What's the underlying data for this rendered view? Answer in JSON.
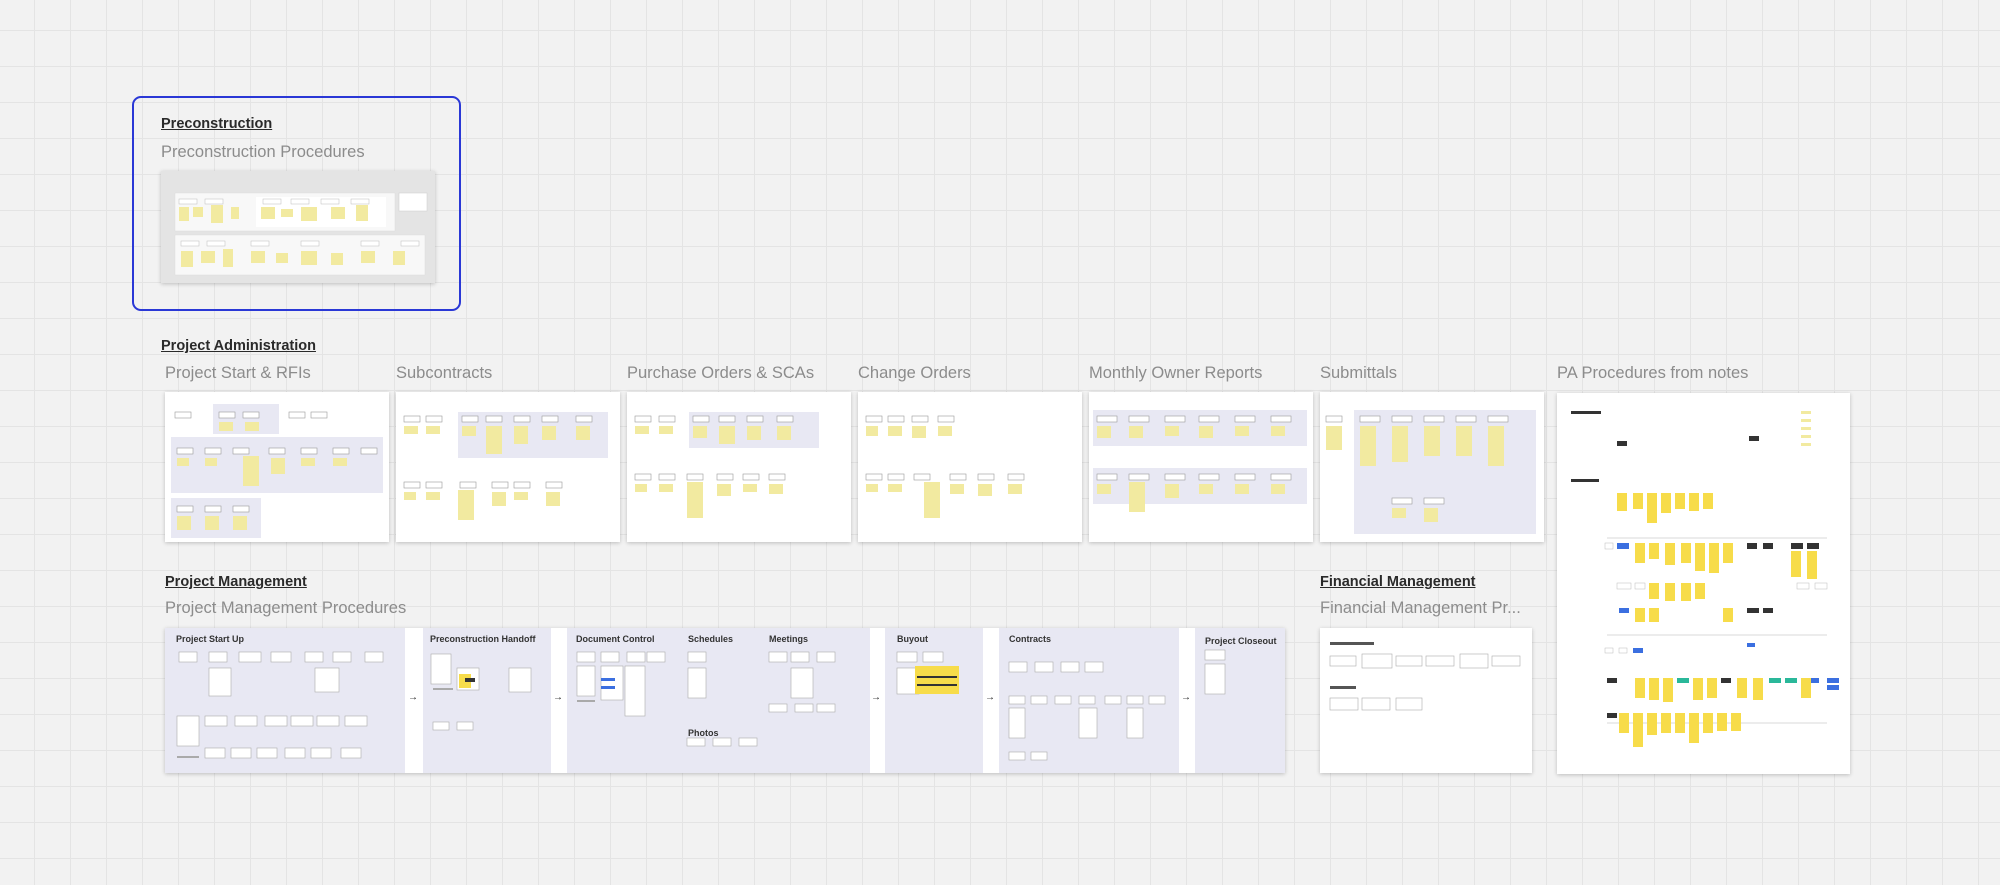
{
  "sections": {
    "preconstruction": "Preconstruction",
    "project_administration": "Project Administration",
    "project_management": "Project Management",
    "financial_management": "Financial Management"
  },
  "frames": {
    "preconstruction_procedures": "Preconstruction Procedures",
    "project_start_rfis": "Project Start & RFIs",
    "subcontracts": "Subcontracts",
    "purchase_orders": "Purchase Orders & SCAs",
    "change_orders": "Change Orders",
    "monthly_owner_reports": "Monthly Owner Reports",
    "submittals": "Submittals",
    "pa_procedures_notes": "PA Procedures from notes",
    "project_management_procedures": "Project Management Procedures",
    "financial_management_procedures": "Financial Management Pr..."
  },
  "pm_panels": {
    "project_start_up": "Project Start Up",
    "preconstruction_handoff": "Preconstruction Handoff",
    "document_control": "Document Control",
    "schedules": "Schedules",
    "meetings": "Meetings",
    "photos": "Photos",
    "buyout": "Buyout",
    "contracts": "Contracts",
    "project_closeout": "Project Closeout"
  },
  "colors": {
    "canvas": "#f2f2f2",
    "selection": "#2a38d6",
    "sticky_yellow": "#f7f0a8",
    "panel_lavender": "#e8e8f3"
  }
}
